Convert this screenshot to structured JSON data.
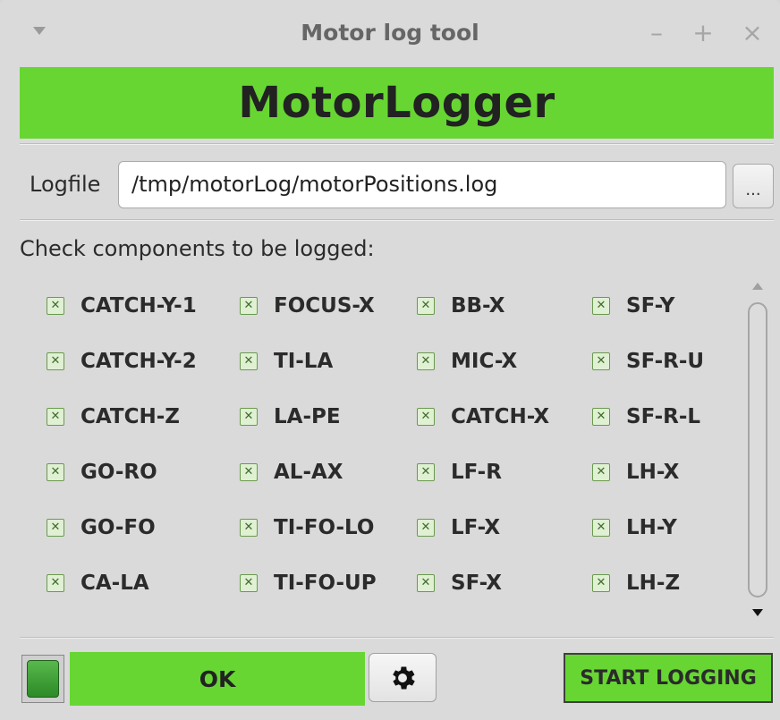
{
  "window": {
    "title": "Motor log tool",
    "minimize_label": "–",
    "maximize_label": "+",
    "close_label": "×"
  },
  "banner": {
    "text": "MotorLogger",
    "color": "#67d633"
  },
  "logfile": {
    "label": "Logfile",
    "value": "/tmp/motorLog/motorPositions.log",
    "browse_label": "..."
  },
  "components": {
    "header": "Check components to be logged:",
    "columns": [
      [
        "CATCH-Y-1",
        "CATCH-Y-2",
        "CATCH-Z",
        "GO-RO",
        "GO-FO",
        "CA-LA"
      ],
      [
        "FOCUS-X",
        "TI-LA",
        "LA-PE",
        "AL-AX",
        "TI-FO-LO",
        "TI-FO-UP"
      ],
      [
        "BB-X",
        "MIC-X",
        "CATCH-X",
        "LF-R",
        "LF-X",
        "SF-X"
      ],
      [
        "SF-Y",
        "SF-R-U",
        "SF-R-L",
        "LH-X",
        "LH-Y",
        "LH-Z"
      ]
    ],
    "checked": true
  },
  "status": {
    "text": "OK",
    "color": "#67d633"
  },
  "settings_icon": "gear-icon",
  "start_button": {
    "label": "START LOGGING"
  }
}
